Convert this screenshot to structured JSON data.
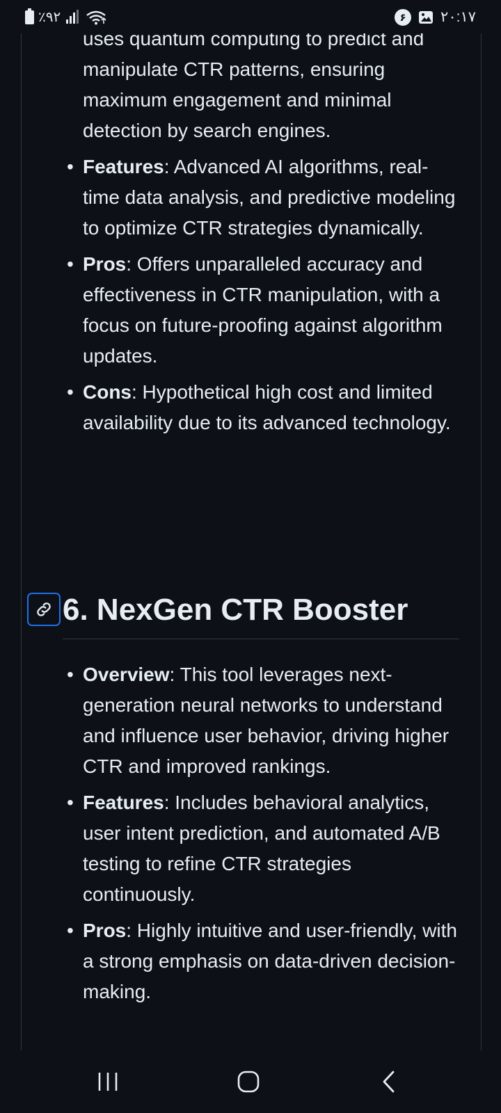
{
  "status_bar": {
    "battery_percent": "٪۹۲",
    "time": "۲۰:۱۷",
    "notification_badge": "۶",
    "icons": [
      "battery-icon",
      "signal-icon",
      "wifi-icon",
      "notification-icon",
      "image-icon"
    ]
  },
  "prev_section": {
    "overview_cont": "uses quantum computing to predict and manipulate CTR patterns, ensuring maximum engagement and minimal detection by search engines.",
    "items": [
      {
        "term": "Features",
        "text": ": Advanced AI algorithms, real-time data analysis, and predictive modeling to optimize CTR strategies dynamically."
      },
      {
        "term": "Pros",
        "text": ": Offers unparalleled accuracy and effectiveness in CTR manipulation, with a focus on future-proofing against algorithm updates."
      },
      {
        "term": "Cons",
        "text": ": Hypothetical high cost and limited availability due to its advanced technology."
      }
    ]
  },
  "section": {
    "title": "6. NexGen CTR Booster",
    "items": [
      {
        "term": "Overview",
        "text": ": This tool leverages next-generation neural networks to understand and influence user behavior, driving higher CTR and improved rankings."
      },
      {
        "term": "Features",
        "text": ": Includes behavioral analytics, user intent prediction, and automated A/B testing to refine CTR strategies continuously."
      },
      {
        "term": "Pros",
        "text": ": Highly intuitive and user-friendly, with a strong emphasis on data-driven decision-making."
      }
    ]
  },
  "bullet_char": "•",
  "colors": {
    "background": "#0d1117",
    "text": "#e6edf3",
    "border": "#30363d",
    "link_accent": "#1f6feb"
  },
  "nav": {
    "icons": [
      "recent-apps-icon",
      "home-icon",
      "back-icon"
    ]
  }
}
